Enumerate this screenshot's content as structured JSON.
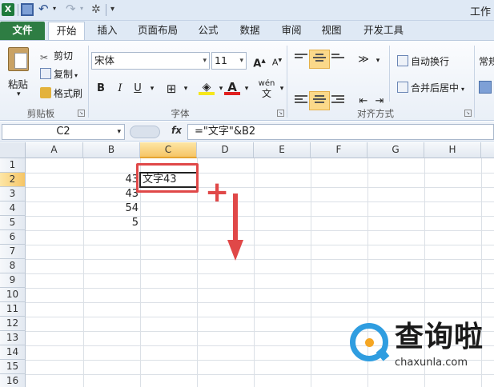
{
  "title_bar": {
    "title": "工作"
  },
  "quick_access": {
    "app_icon": "excel-icon",
    "save_icon": "save-icon",
    "undo_icon": "undo-icon",
    "redo_icon": "redo-icon",
    "wand_icon": "wand-icon",
    "more_icon": "dropdown-icon"
  },
  "ribbon_tabs": [
    {
      "label": "文件"
    },
    {
      "label": "开始"
    },
    {
      "label": "插入"
    },
    {
      "label": "页面布局"
    },
    {
      "label": "公式"
    },
    {
      "label": "数据"
    },
    {
      "label": "审阅"
    },
    {
      "label": "视图"
    },
    {
      "label": "开发工具"
    }
  ],
  "clipboard": {
    "paste": "粘贴",
    "cut": "剪切",
    "copy": "复制",
    "painter": "格式刷",
    "group": "剪贴板"
  },
  "font": {
    "name": "宋体",
    "size": "11",
    "bold": "B",
    "italic": "I",
    "underline": "U",
    "group": "字体",
    "wen": "wén",
    "grow": "A",
    "shrink": "A"
  },
  "alignment": {
    "wrap": "自动换行",
    "merge": "合并后居中",
    "group": "对齐方式",
    "next": "常规"
  },
  "formula_bar": {
    "name_box": "C2",
    "fx": "fx",
    "formula": "=\"文字\"&B2"
  },
  "columns": [
    "A",
    "B",
    "C",
    "D",
    "E",
    "F",
    "G",
    "H"
  ],
  "rows": [
    "1",
    "2",
    "3",
    "4",
    "5",
    "6",
    "7",
    "8",
    "9",
    "10",
    "11",
    "12",
    "13",
    "14",
    "15",
    "16"
  ],
  "cells": {
    "B2": "43",
    "B3": "43",
    "B4": "54",
    "B5": "5",
    "C2": "文字43"
  },
  "annotations": {
    "plus": "+"
  },
  "watermark": {
    "text": "查询啦",
    "url": "chaxunla.com"
  }
}
